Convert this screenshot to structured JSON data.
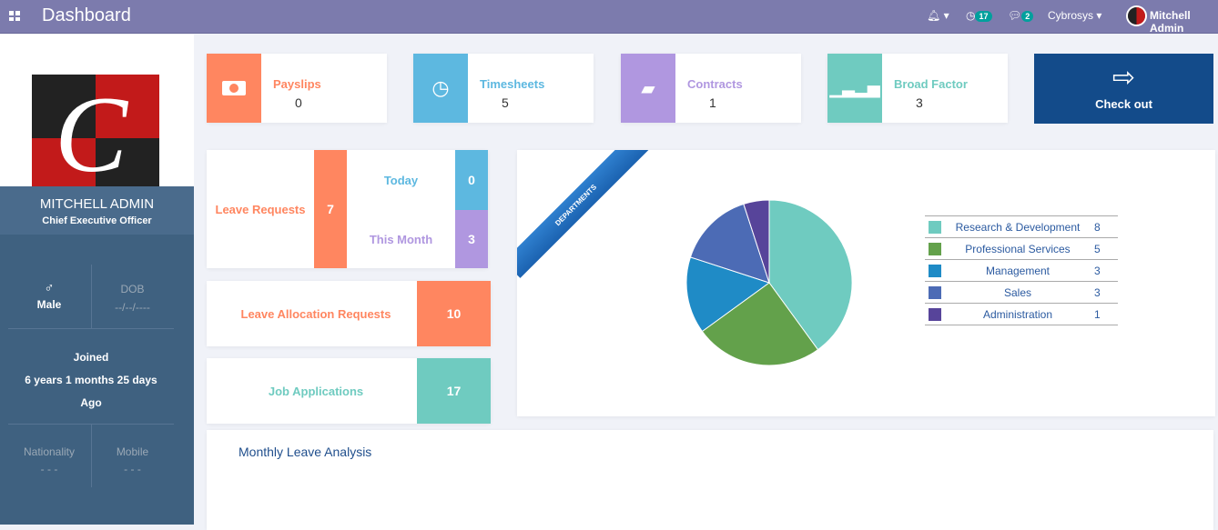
{
  "header": {
    "title": "Dashboard",
    "activity_count": "17",
    "message_count": "2",
    "company": "Cybrosys",
    "user": "Mitchell Admin"
  },
  "profile": {
    "name": "MITCHELL ADMIN",
    "job": "Chief Executive Officer",
    "gender": "Male",
    "dob_label": "DOB",
    "dob": "--/--/----",
    "joined_label": "Joined",
    "joined": "6 years 1 months 25 days",
    "ago": "Ago",
    "nationality_label": "Nationality",
    "nationality": "- - -",
    "mobile_label": "Mobile",
    "mobile": "- - -"
  },
  "stats": [
    {
      "label": "Payslips",
      "value": "0",
      "color": "#ff8660",
      "icon": "money-icon"
    },
    {
      "label": "Timesheets",
      "value": "5",
      "color": "#5db8e0",
      "icon": "clock-icon"
    },
    {
      "label": "Contracts",
      "value": "1",
      "color": "#b097e0",
      "icon": "book-icon"
    },
    {
      "label": "Broad Factor",
      "value": "3",
      "color": "#6fcbc0",
      "icon": "bar-chart-icon"
    }
  ],
  "checkout": {
    "label": "Check out",
    "color": "#134b8a"
  },
  "leave": {
    "label": "Leave Requests",
    "value": "7",
    "today_label": "Today",
    "today": "0",
    "month_label": "This Month",
    "month": "3"
  },
  "allocation": {
    "label": "Leave Allocation Requests",
    "value": "10"
  },
  "jobs": {
    "label": "Job Applications",
    "value": "17"
  },
  "departments": {
    "ribbon": "DEPARTMENTS",
    "chart_data": {
      "type": "pie",
      "categories": [
        "Research & Development",
        "Professional Services",
        "Management",
        "Sales",
        "Administration"
      ],
      "values": [
        8,
        5,
        3,
        3,
        1
      ],
      "colors": [
        "#6fcbc0",
        "#63a14b",
        "#1f8bc6",
        "#4c6bb5",
        "#57449a"
      ],
      "legend": "right"
    }
  },
  "monthly": {
    "title": "Monthly Leave Analysis"
  }
}
